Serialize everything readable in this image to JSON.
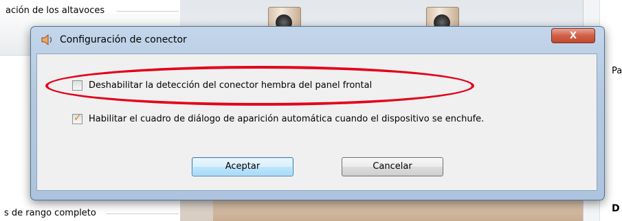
{
  "background": {
    "group_label_top": "ación de los altavoces",
    "group_label_bottom": "s de rango completo",
    "right_label_1": "Pa",
    "right_label_2": "D"
  },
  "dialog": {
    "title": "Configuración de conector",
    "close_label": "X",
    "options": [
      {
        "label": "Deshabilitar la detección del conector hembra del panel frontal",
        "checked": false
      },
      {
        "label": "Habilitar el cuadro de diálogo de aparición automática cuando el dispositivo se enchufe.",
        "checked": true
      }
    ],
    "ok_label": "Aceptar",
    "cancel_label": "Cancelar"
  },
  "colors": {
    "annotation": "#e3001b",
    "checkmark": "#d4851c",
    "close_button": "#d15f45"
  },
  "icons": {
    "title_icon": "speaker-icon",
    "check_icon": "checkmark-icon"
  }
}
